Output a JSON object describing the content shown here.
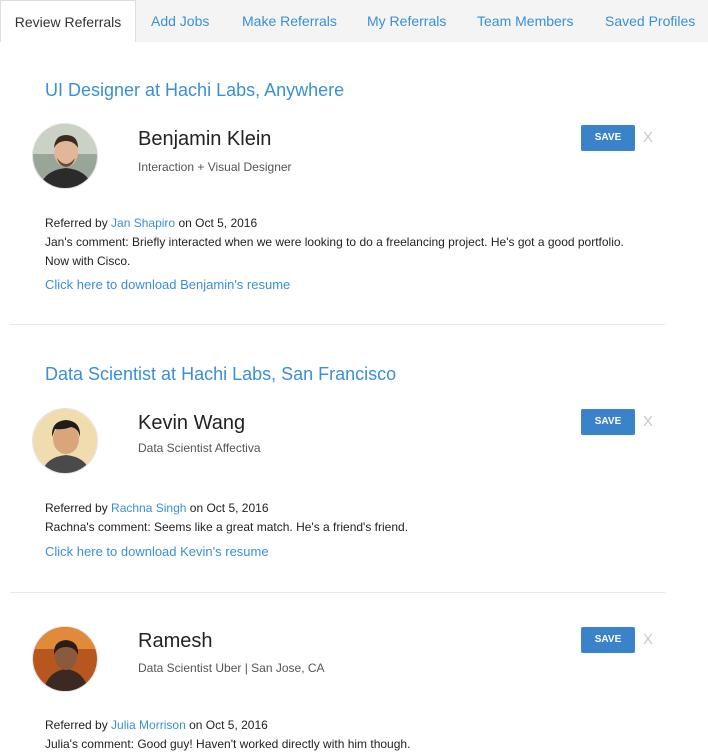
{
  "tabs": [
    {
      "label": "Review Referrals",
      "active": true
    },
    {
      "label": "Add Jobs",
      "active": false
    },
    {
      "label": "Make Referrals",
      "active": false
    },
    {
      "label": "My Referrals",
      "active": false
    },
    {
      "label": "Team Members",
      "active": false
    },
    {
      "label": "Saved Profiles",
      "active": false
    }
  ],
  "referrals": [
    {
      "job_title": "UI Designer at Hachi Labs, Anywhere",
      "candidate_name": "Benjamin Klein",
      "headline": "Interaction + Visual Designer",
      "save_label": "SAVE",
      "close_label": "X",
      "referred_by_prefix": "Referred by",
      "referrer": "Jan Shapiro",
      "date_text": "on Oct 5, 2016",
      "comment": "Jan's comment: Briefly interacted when we were looking to do a freelancing project. He's got a good portfolio. Now with Cisco.",
      "download_text": "Click here to download Benjamin's resume",
      "avatar": "profile-photo"
    },
    {
      "job_title": "Data Scientist at Hachi Labs, San Francisco",
      "candidate_name": "Kevin Wang",
      "headline": "Data Scientist Affectiva",
      "save_label": "SAVE",
      "close_label": "X",
      "referred_by_prefix": "Referred by",
      "referrer": "Rachna Singh",
      "date_text": "on Oct 5, 2016",
      "comment": "Rachna's comment: Seems like a great match. He's a friend's friend.",
      "download_text": "Click here to download Kevin's resume",
      "avatar": "profile-photo"
    },
    {
      "candidate_name": "Ramesh",
      "headline": "Data Scientist Uber | San Jose, CA",
      "save_label": "SAVE",
      "close_label": "X",
      "referred_by_prefix": "Referred by",
      "referrer": "Julia Morrison",
      "date_text": "on Oct 5, 2016",
      "comment": "Julia's comment: Good guy! Haven't worked directly with him though.",
      "avatar": "profile-photo"
    }
  ],
  "colors": {
    "link": "#3a8fd6",
    "save_button": "#3a82c9",
    "tab_bar": "#f4f4f4"
  }
}
